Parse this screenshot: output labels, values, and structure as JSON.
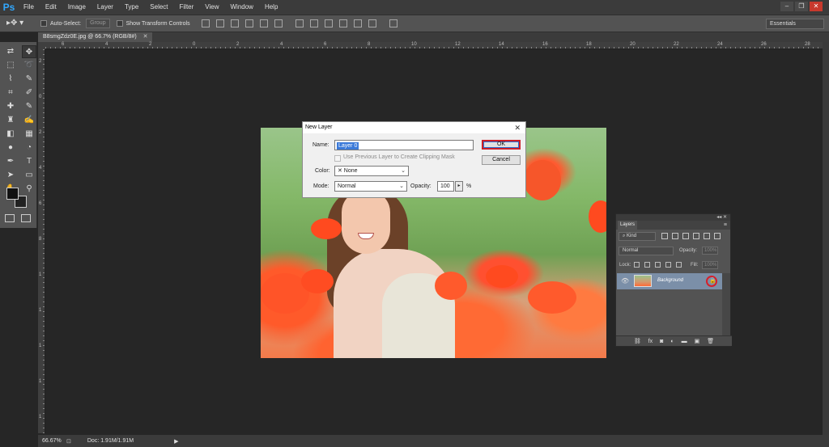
{
  "app": {
    "logo": "Ps"
  },
  "menu": [
    "File",
    "Edit",
    "Image",
    "Layer",
    "Type",
    "Select",
    "Filter",
    "View",
    "Window",
    "Help"
  ],
  "window_controls": {
    "minimize": "–",
    "restore": "❐",
    "close": "✕"
  },
  "options_bar": {
    "tool_glyph": "▸✥ ▾",
    "auto_select_label": "Auto-Select:",
    "group_value": "Group",
    "show_transform_label": "Show Transform Controls",
    "workspace": "Essentials"
  },
  "document_tab": {
    "title": "B8smgZdz0E.jpg @ 66.7% (RGB/8#)",
    "close": "✕"
  },
  "ruler_h_numbers": [
    "6",
    "4",
    "2",
    "0",
    "2",
    "4",
    "6",
    "8",
    "10",
    "12",
    "14",
    "16",
    "18",
    "20",
    "22",
    "24",
    "26",
    "28"
  ],
  "ruler_v_numbers": [
    "2",
    "0",
    "2",
    "4",
    "6",
    "8",
    "1",
    "1",
    "1",
    "1",
    "1"
  ],
  "tools": [
    {
      "name": "move-tool-icon",
      "glyph": "⇄",
      "active": false
    },
    {
      "name": "move-active-tool-icon",
      "glyph": "✥",
      "active": true
    },
    {
      "name": "marquee-tool-icon",
      "glyph": "⬚",
      "active": false
    },
    {
      "name": "lasso-tool-icon",
      "glyph": "➰",
      "active": false
    },
    {
      "name": "lasso-alt-tool-icon",
      "glyph": "⌇",
      "active": false
    },
    {
      "name": "magic-wand-tool-icon",
      "glyph": "✎",
      "active": false
    },
    {
      "name": "crop-tool-icon",
      "glyph": "⌗",
      "active": false
    },
    {
      "name": "eyedropper-tool-icon",
      "glyph": "✐",
      "active": false
    },
    {
      "name": "healing-brush-tool-icon",
      "glyph": "✚",
      "active": false
    },
    {
      "name": "brush-tool-icon",
      "glyph": "✎",
      "active": false
    },
    {
      "name": "clone-stamp-tool-icon",
      "glyph": "♜",
      "active": false
    },
    {
      "name": "history-brush-tool-icon",
      "glyph": "✍",
      "active": false
    },
    {
      "name": "eraser-tool-icon",
      "glyph": "◧",
      "active": false
    },
    {
      "name": "gradient-tool-icon",
      "glyph": "▦",
      "active": false
    },
    {
      "name": "blur-tool-icon",
      "glyph": "●",
      "active": false
    },
    {
      "name": "dodge-tool-icon",
      "glyph": "◔",
      "active": false
    },
    {
      "name": "pen-tool-icon",
      "glyph": "✒",
      "active": false
    },
    {
      "name": "type-tool-icon",
      "glyph": "T",
      "active": false
    },
    {
      "name": "path-select-tool-icon",
      "glyph": "➤",
      "active": false
    },
    {
      "name": "shape-tool-icon",
      "glyph": "▭",
      "active": false
    },
    {
      "name": "hand-tool-icon",
      "glyph": "✋",
      "active": false
    },
    {
      "name": "zoom-tool-icon",
      "glyph": "⚲",
      "active": false
    }
  ],
  "dialog": {
    "title": "New Layer",
    "close": "✕",
    "name_label": "Name:",
    "name_value": "Layer 0",
    "clipping_label": "Use Previous Layer to Create Clipping Mask",
    "color_label": "Color:",
    "color_value": "✕ None",
    "mode_label": "Mode:",
    "mode_value": "Normal",
    "opacity_label": "Opacity:",
    "opacity_value": "100",
    "opacity_arrow": "▸",
    "percent": "%",
    "caret": "⌄",
    "ok_label": "OK",
    "cancel_label": "Cancel"
  },
  "layers_panel": {
    "top_icons": "◂◂ ✕",
    "tab_label": "Layers",
    "menu_icon": "≡",
    "kind_value": "⌕ Kind",
    "blend_value": "Normal",
    "opacity_label": "Opacity:",
    "opacity_value": "100%",
    "lock_label": "Lock:",
    "fill_label": "Fill:",
    "fill_value": "100%",
    "layer_name": "Background",
    "eye_glyph": "👁",
    "lock_glyph": "🔒",
    "bottom_icons": [
      "⛓",
      "fx",
      "◙",
      "◐",
      "▬",
      "▣",
      "🗑"
    ]
  },
  "status_bar": {
    "zoom": "66.67%",
    "doc": "Doc: 1.91M/1.91M",
    "arrow": "▶"
  }
}
